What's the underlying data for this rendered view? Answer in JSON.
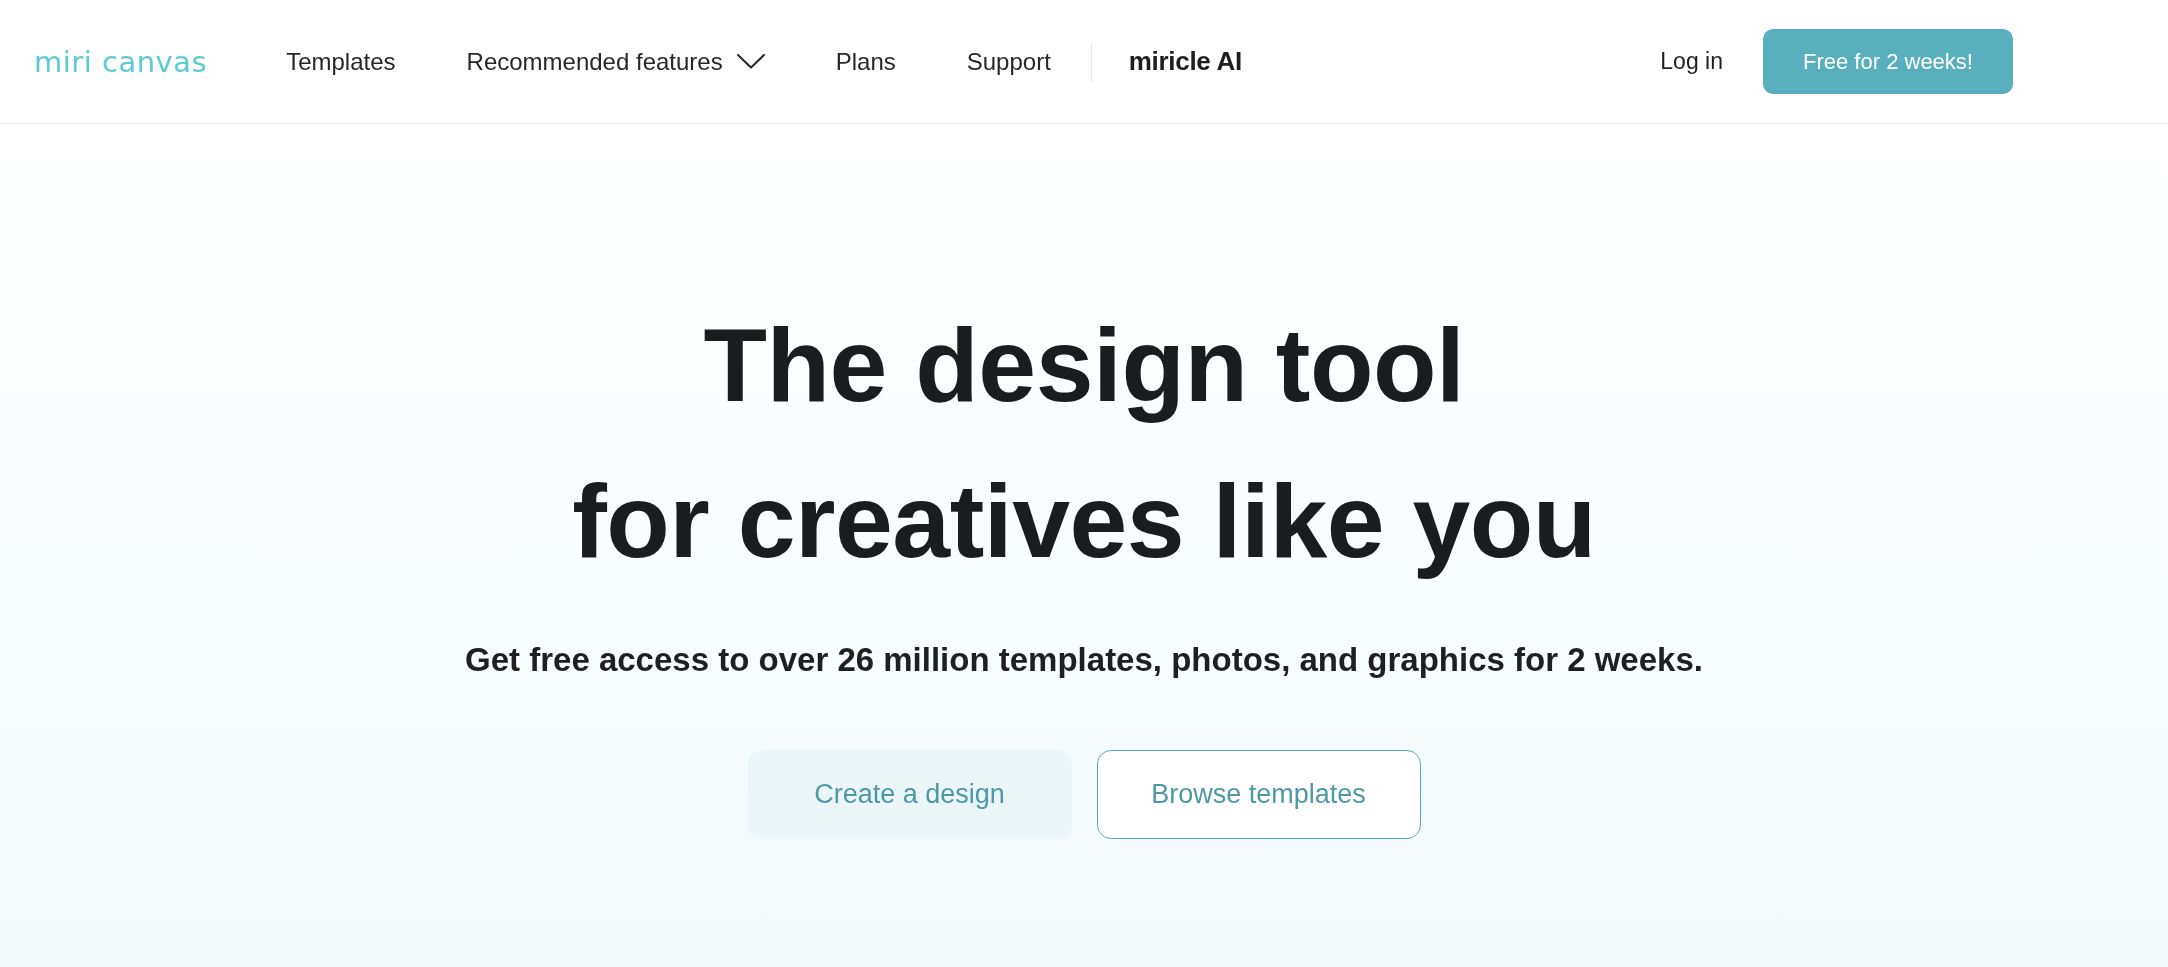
{
  "header": {
    "logo": "miri canvas",
    "nav": [
      {
        "label": "Templates",
        "kind": "link"
      },
      {
        "label": "Recommended features",
        "kind": "dropdown"
      },
      {
        "label": "Plans",
        "kind": "link"
      },
      {
        "label": "Support",
        "kind": "link"
      }
    ],
    "brand_link": "miricle AI",
    "login": "Log in",
    "cta": "Free for 2 weeks!"
  },
  "hero": {
    "title_lines": [
      "The design tool",
      "for creatives like you"
    ],
    "subtitle": "Get free access to over 26 million templates, photos, and graphics for 2 weeks.",
    "buttons": [
      {
        "label": "Create a design",
        "kind": "filled"
      },
      {
        "label": "Browse templates",
        "kind": "outline"
      }
    ]
  }
}
